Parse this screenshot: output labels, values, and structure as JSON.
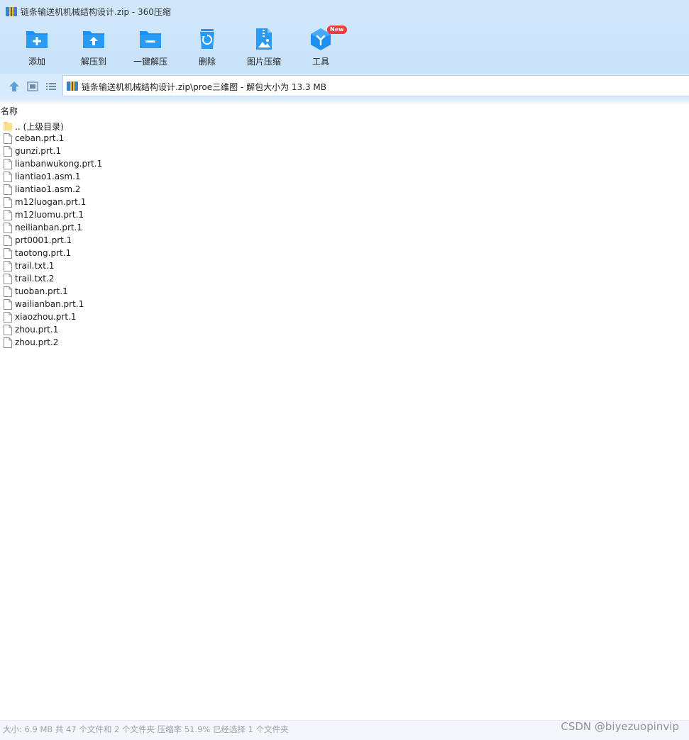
{
  "window": {
    "title": "链条输送机机械结构设计.zip - 360压缩"
  },
  "toolbar": {
    "items": [
      {
        "label": "添加",
        "icon": "add-folder-icon"
      },
      {
        "label": "解压到",
        "icon": "extract-to-icon"
      },
      {
        "label": "一键解压",
        "icon": "one-click-extract-icon"
      },
      {
        "label": "删除",
        "icon": "recycle-bin-icon"
      },
      {
        "label": "图片压缩",
        "icon": "image-compress-icon"
      },
      {
        "label": "工具",
        "icon": "tools-cube-icon",
        "badge": "New"
      }
    ]
  },
  "address": {
    "path": "链条输送机机械结构设计.zip\\proe三维图 - 解包大小为 13.3 MB"
  },
  "list": {
    "column_header": "名称",
    "items": [
      {
        "name": ".. (上级目录)",
        "type": "folder"
      },
      {
        "name": "ceban.prt.1",
        "type": "file"
      },
      {
        "name": "gunzi.prt.1",
        "type": "file"
      },
      {
        "name": "lianbanwukong.prt.1",
        "type": "file"
      },
      {
        "name": "liantiao1.asm.1",
        "type": "file"
      },
      {
        "name": "liantiao1.asm.2",
        "type": "file"
      },
      {
        "name": "m12luogan.prt.1",
        "type": "file"
      },
      {
        "name": "m12luomu.prt.1",
        "type": "file"
      },
      {
        "name": "neilianban.prt.1",
        "type": "file"
      },
      {
        "name": "prt0001.prt.1",
        "type": "file"
      },
      {
        "name": "taotong.prt.1",
        "type": "file"
      },
      {
        "name": "trail.txt.1",
        "type": "file"
      },
      {
        "name": "trail.txt.2",
        "type": "file"
      },
      {
        "name": "tuoban.prt.1",
        "type": "file"
      },
      {
        "name": "wailianban.prt.1",
        "type": "file"
      },
      {
        "name": "xiaozhou.prt.1",
        "type": "file"
      },
      {
        "name": "zhou.prt.1",
        "type": "file"
      },
      {
        "name": "zhou.prt.2",
        "type": "file"
      }
    ]
  },
  "status": {
    "text": "大小: 6.9 MB 共 47 个文件和 2 个文件夹 压缩率 51.9% 已经选择 1 个文件夹"
  },
  "watermark": "CSDN @biyezuopinvip",
  "colors": {
    "accent": "#1e8ff0",
    "titlebar": "#cfe6fb",
    "badge": "#f03a3a"
  }
}
